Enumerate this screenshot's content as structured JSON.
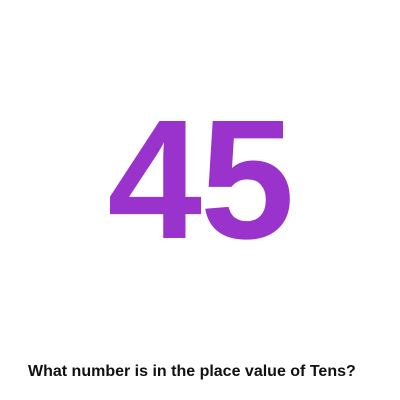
{
  "card": {
    "number": "45",
    "number_color": "#9933cc",
    "question": "What number is in the place value of Tens?"
  }
}
